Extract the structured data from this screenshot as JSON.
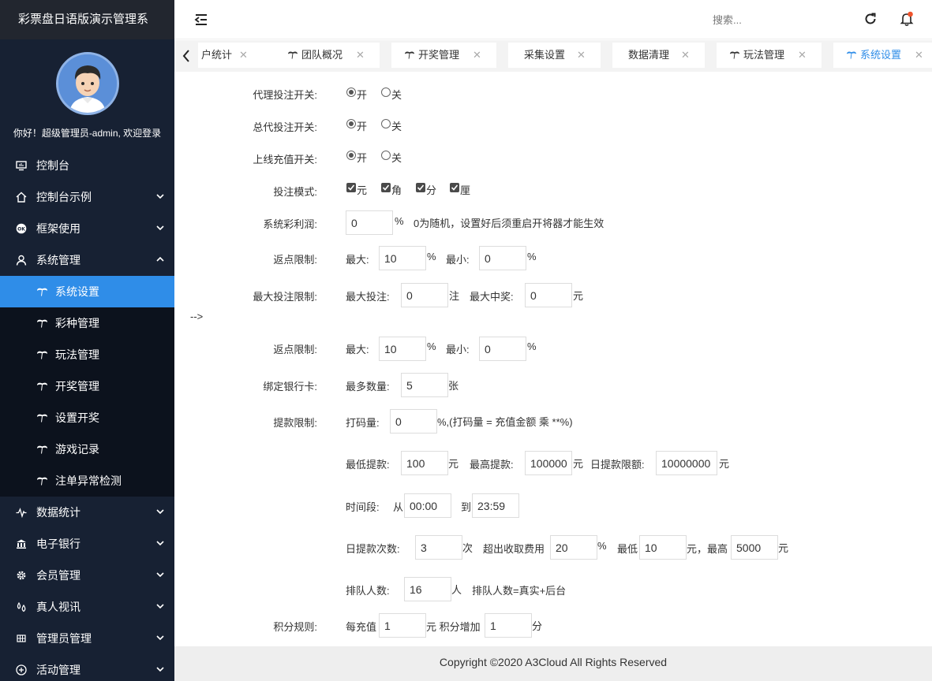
{
  "sidebar": {
    "brand": "彩票盘日语版演示管理系",
    "welcome": "你好！超级管理员-admin, 欢迎登录",
    "menu": {
      "console": "控制台",
      "console_demo": "控制台示例",
      "framework": "框架使用",
      "system": "系统管理",
      "data_stats": "数据统计",
      "ebank": "电子银行",
      "members": "会员管理",
      "live": "真人视讯",
      "admins": "管理员管理",
      "activities": "活动管理"
    },
    "system_sub": [
      "系统设置",
      "彩种管理",
      "玩法管理",
      "开奖管理",
      "设置开奖",
      "游戏记录",
      "注单异常检测"
    ]
  },
  "header": {
    "search_placeholder": "搜索..."
  },
  "tabs": [
    "户统计",
    "团队概况",
    "开奖管理",
    "采集设置",
    "数据清理",
    "玩法管理",
    "系统设置"
  ],
  "form": {
    "agent_bet": {
      "label": "代理投注开关:",
      "on": "开",
      "off": "关",
      "value": "开"
    },
    "general_agent_bet": {
      "label": "总代投注开关:",
      "on": "开",
      "off": "关",
      "value": "开"
    },
    "online_recharge": {
      "label": "上线充值开关:",
      "on": "开",
      "off": "关",
      "value": "开"
    },
    "bet_mode": {
      "label": "投注模式:",
      "options": [
        "元",
        "角",
        "分",
        "厘"
      ]
    },
    "profit": {
      "label": "系统彩利润:",
      "value": "0",
      "unit": "%",
      "hint": "0为随机，设置好后须重启开将器才能生效"
    },
    "rebate": {
      "label": "返点限制:",
      "max_label": "最大:",
      "max": "10",
      "unit": "%",
      "min_label": "最小:",
      "min": "0"
    },
    "max_bet": {
      "label": "最大投注限制:",
      "bet_label": "最大投注:",
      "bet": "0",
      "bet_unit": "注",
      "win_label": "最大中奖:",
      "win": "0",
      "win_unit": "元"
    },
    "stray_text": "-->",
    "rebate2": {
      "label": "返点限制:",
      "max_label": "最大:",
      "max": "10",
      "unit": "%",
      "min_label": "最小:",
      "min": "0"
    },
    "bank_card": {
      "label": "绑定银行卡:",
      "count_label": "最多数量:",
      "count": "5",
      "unit": "张"
    },
    "withdraw": {
      "label": "提款限制:",
      "code_label": "打码量:",
      "code": "0",
      "code_hint": "%,(打码量 = 充值金额 乘 **%)",
      "min_label": "最低提款:",
      "min": "100",
      "yuan": "元",
      "max_label": "最高提款:",
      "max": "100000",
      "daily_label": "日提款限额:",
      "daily": "10000000",
      "time_label": "时间段:",
      "from_label": "从",
      "from": "00:00",
      "to_label": "到",
      "to": "23:59",
      "times_label": "日提款次数:",
      "times": "3",
      "times_unit": "次",
      "fee_label": "超出收取费用",
      "fee": "20",
      "fee_unit": "%",
      "fee_min_label": "最低",
      "fee_min": "10",
      "fee_max_label": "元，最高",
      "fee_max": "5000",
      "queue_label": "排队人数:",
      "queue": "16",
      "queue_unit": "人",
      "queue_hint": "排队人数=真实+后台"
    },
    "points": {
      "label": "积分规则:",
      "per_label": "每充值",
      "per": "1",
      "mid_label": "元 积分增加",
      "add": "1",
      "unit": "分"
    }
  },
  "footer": "Copyright ©2020 A3Cloud All Rights Reserved"
}
